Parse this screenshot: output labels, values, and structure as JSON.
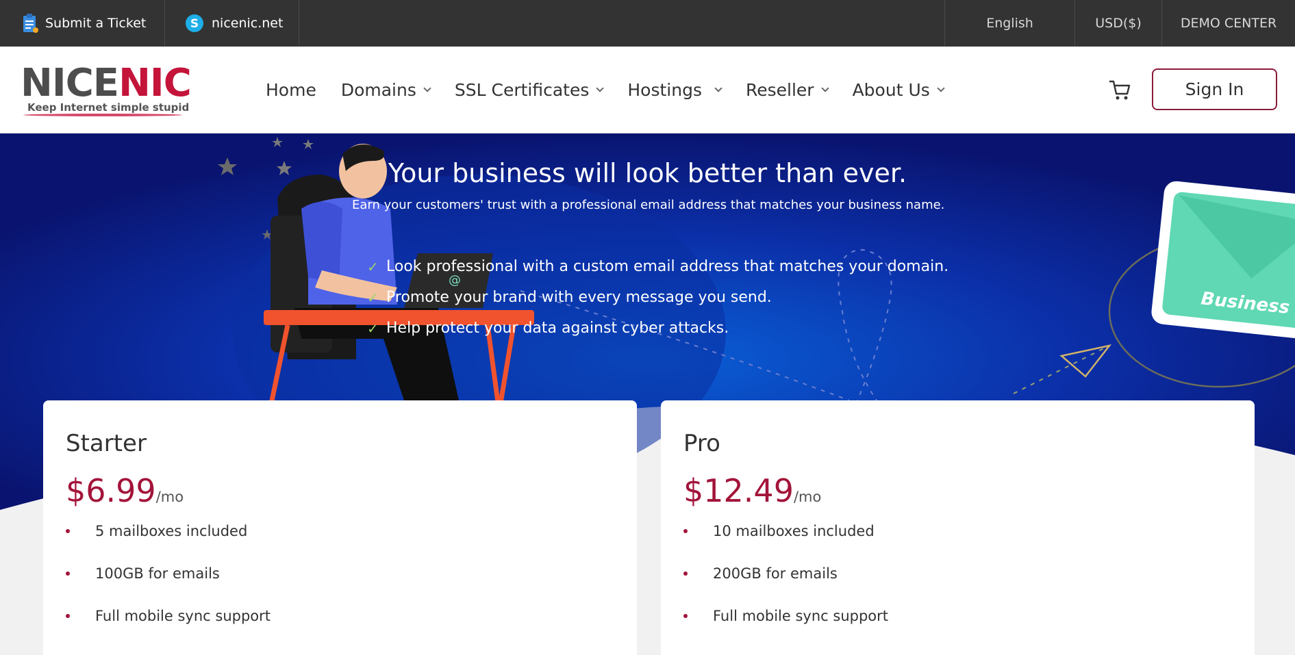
{
  "topbar": {
    "ticket_label": "Submit a Ticket",
    "skype_label": "nicenic.net",
    "language": "English",
    "currency": "USD($)",
    "demo": "DEMO CENTER"
  },
  "brand": {
    "word_a": "NICE",
    "word_b": "NIC",
    "tagline": "Keep Internet simple stupid",
    "color_primary": "#a3143a",
    "color_dark": "#4d4d4d"
  },
  "nav": {
    "items": [
      {
        "label": "Home",
        "dropdown": false
      },
      {
        "label": "Domains",
        "dropdown": true
      },
      {
        "label": "SSL Certificates",
        "dropdown": true
      },
      {
        "label": "Hostings",
        "dropdown": true
      },
      {
        "label": "Reseller",
        "dropdown": true
      },
      {
        "label": "About Us",
        "dropdown": true
      }
    ],
    "signin": "Sign In"
  },
  "hero": {
    "title": "Your business will look better than ever.",
    "subtitle": "Earn your customers' trust with a professional email address that matches your business name.",
    "features": [
      "Look professional with a custom email address that matches your domain.",
      "Promote your brand with every message you send.",
      "Help protect your data against cyber attacks."
    ],
    "envelope_text": "Business Em",
    "at_sign": "@",
    "bg_color": "#0b1f8f"
  },
  "plans": [
    {
      "name": "Starter",
      "price": "$6.99",
      "period": "/mo",
      "features": [
        "5 mailboxes included",
        "100GB for emails",
        "Full mobile sync support"
      ]
    },
    {
      "name": "Pro",
      "price": "$12.49",
      "period": "/mo",
      "features": [
        "10 mailboxes included",
        "200GB for emails",
        "Full mobile sync support"
      ]
    }
  ]
}
